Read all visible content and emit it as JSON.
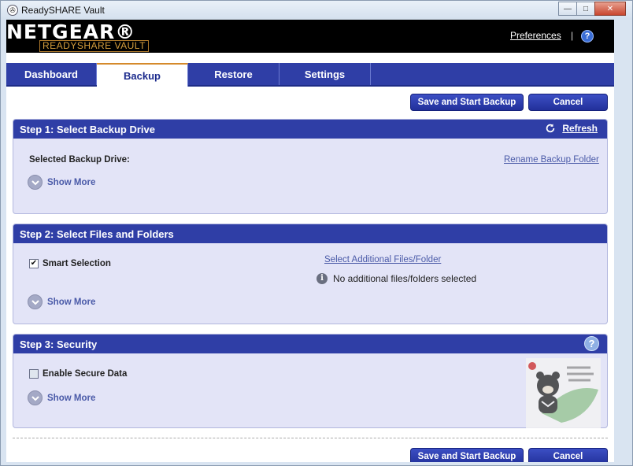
{
  "window": {
    "title": "ReadySHARE Vault",
    "controls": {
      "minimize": "—",
      "maximize": "□",
      "close": "✕"
    }
  },
  "header": {
    "logo": "NETGEAR®",
    "logo_sub": "READYSHARE VAULT",
    "preferences_link": "Preferences",
    "separator": "|",
    "help_label": "?"
  },
  "tabs": [
    {
      "label": "Dashboard",
      "active": false
    },
    {
      "label": "Backup",
      "active": true
    },
    {
      "label": "Restore",
      "active": false
    },
    {
      "label": "Settings",
      "active": false
    }
  ],
  "actions": {
    "save_start": "Save and Start Backup",
    "cancel": "Cancel"
  },
  "step1": {
    "title": "Step 1: Select Backup Drive",
    "refresh": "Refresh",
    "selected_drive_label": "Selected Backup Drive:",
    "rename_link": "Rename Backup Folder",
    "show_more": "Show More"
  },
  "step2": {
    "title": "Step 2: Select Files and Folders",
    "smart_selection": "Smart Selection",
    "smart_selection_checked": true,
    "select_additional_link": "Select Additional Files/Folder",
    "no_additional": "No additional files/folders selected",
    "show_more": "Show More"
  },
  "step3": {
    "title": "Step 3: Security",
    "help": "?",
    "enable_secure": "Enable Secure Data",
    "enable_secure_checked": false,
    "show_more": "Show More"
  },
  "colors": {
    "accent": "#2f3ea6",
    "panel_bg": "#e3e4f7",
    "tab_active_border": "#d58a2b",
    "logo_sub": "#d69e3c"
  }
}
